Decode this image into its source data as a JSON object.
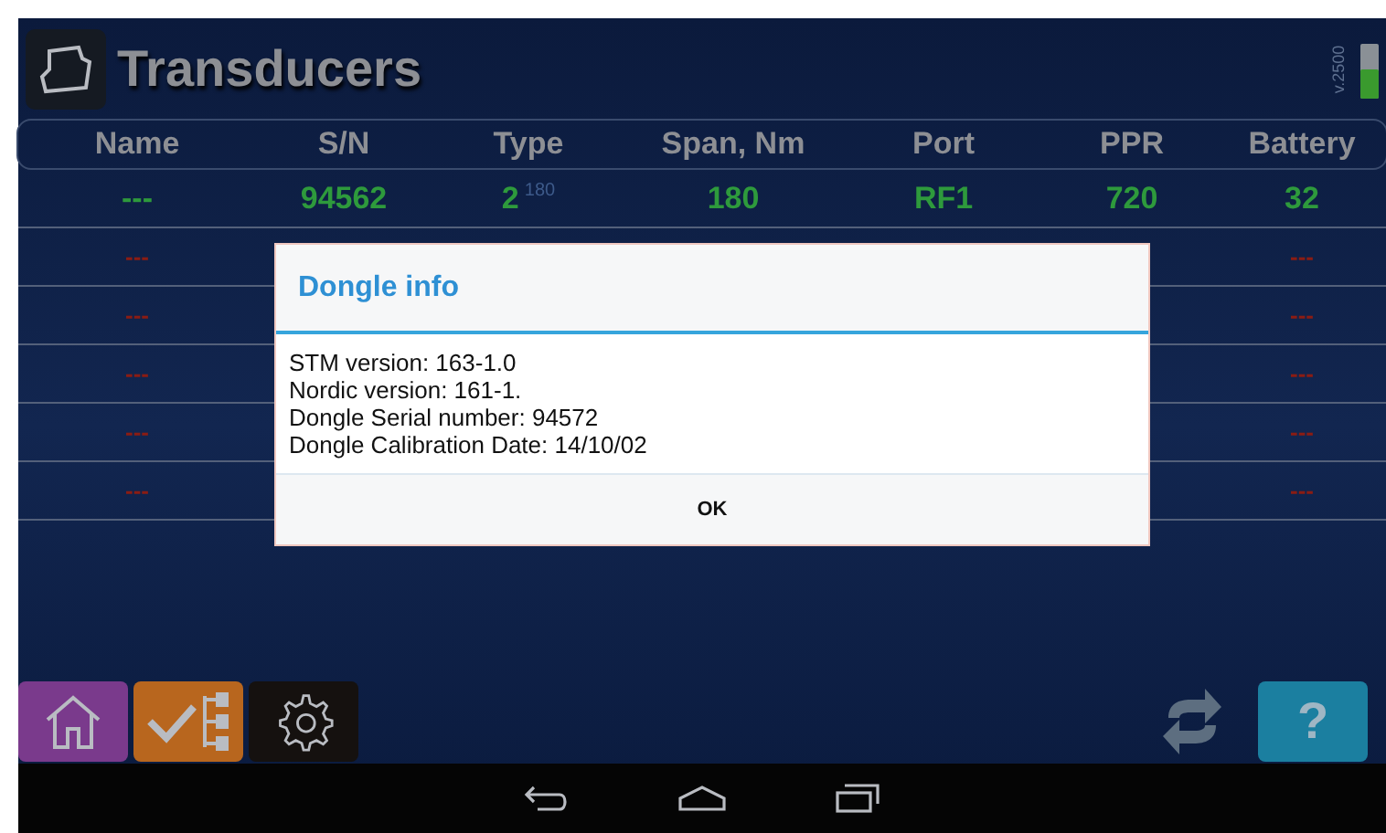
{
  "header": {
    "title": "Transducers",
    "version": "v.2500"
  },
  "table": {
    "columns": [
      "Name",
      "S/N",
      "Type",
      "Span, Nm",
      "Port",
      "PPR",
      "Battery"
    ],
    "rows": [
      {
        "kind": "active",
        "name": "---",
        "sn": "94562",
        "type": "2",
        "type_sup": "180",
        "span": "180",
        "port": "RF1",
        "ppr": "720",
        "battery": "32"
      },
      {
        "kind": "empty",
        "name": "---",
        "battery": "---"
      },
      {
        "kind": "empty",
        "name": "---",
        "battery": "---"
      },
      {
        "kind": "empty",
        "name": "---",
        "battery": "---"
      },
      {
        "kind": "empty",
        "name": "---",
        "battery": "---"
      },
      {
        "kind": "empty",
        "name": "---",
        "battery": "---"
      }
    ]
  },
  "dialog": {
    "title": "Dongle info",
    "lines": [
      "STM version: 163-1.0",
      "Nordic version: 161-1.",
      "Dongle Serial number: 94572",
      "Dongle Calibration Date: 14/10/02"
    ],
    "button": "OK"
  },
  "toolbar": {
    "help": "?"
  }
}
